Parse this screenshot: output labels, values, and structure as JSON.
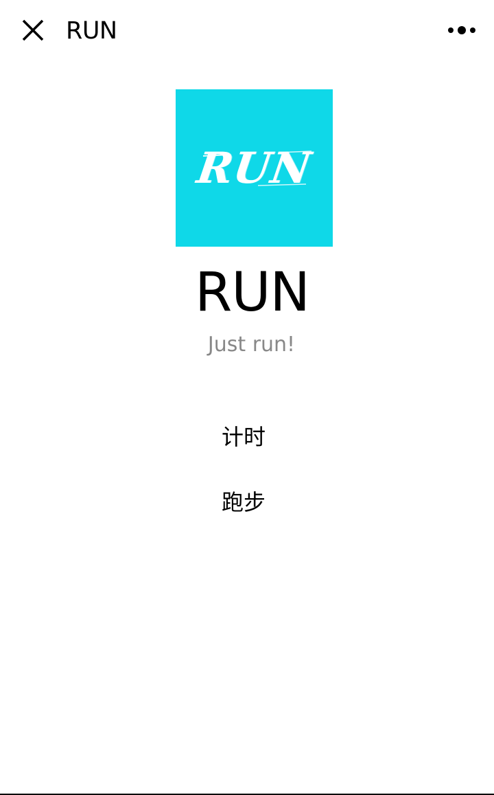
{
  "navbar": {
    "title": "RUN",
    "close_icon": "close-icon",
    "more_icon": "more-dots-icon"
  },
  "logo": {
    "text": "RUN",
    "background_color": "#0fd8e8"
  },
  "app": {
    "name": "RUN",
    "slogan": "Just run!"
  },
  "menu": {
    "items": [
      {
        "label": "计时"
      },
      {
        "label": "跑步"
      }
    ]
  }
}
